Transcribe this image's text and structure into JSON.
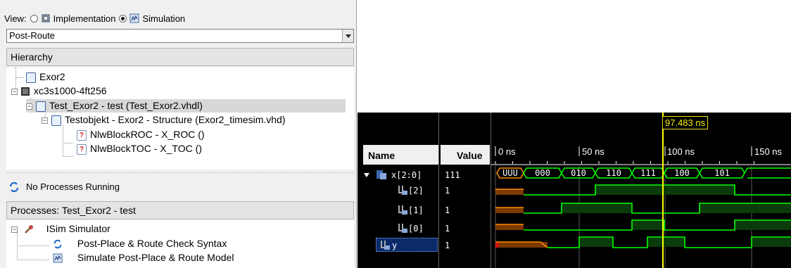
{
  "view": {
    "label": "View:",
    "options": [
      "Implementation",
      "Simulation"
    ],
    "selected": "Simulation"
  },
  "design_combo": {
    "value": "Post-Route"
  },
  "hierarchy": {
    "title": "Hierarchy",
    "items": [
      {
        "label": "Exor2",
        "icon": "document-icon"
      },
      {
        "label": "xc3s1000-4ft256",
        "icon": "chip-icon"
      },
      {
        "label": "Test_Exor2 - test (Test_Exor2.vhdl)",
        "icon": "vhdl-file-icon"
      },
      {
        "label": "Testobjekt - Exor2 - Structure (Exor2_timesim.vhd)",
        "icon": "vhdl-file-icon"
      },
      {
        "label": "NlwBlockROC - X_ROC ()",
        "icon": "unknown-file-icon"
      },
      {
        "label": "NlwBlockTOC - X_TOC ()",
        "icon": "unknown-file-icon"
      }
    ]
  },
  "status": {
    "text": "No Processes Running"
  },
  "processes": {
    "title": "Processes: Test_Exor2 - test",
    "items": [
      {
        "label": "ISim Simulator",
        "icon": "tools-icon"
      },
      {
        "label": "Post-Place & Route Check Syntax",
        "icon": "refresh-icon"
      },
      {
        "label": "Simulate Post-Place & Route Model",
        "icon": "isim-icon"
      }
    ]
  },
  "waveform": {
    "name_header": "Name",
    "value_header": "Value",
    "cursor_label": "97.483 ns",
    "ticks": [
      "0 ns",
      "50 ns",
      "100 ns",
      "150 ns"
    ],
    "signals": [
      {
        "name": "x[2:0]",
        "value": "111",
        "bus_values": [
          "UUU",
          "000",
          "010",
          "110",
          "111",
          "100",
          "101"
        ]
      },
      {
        "name": "[2]",
        "value": "1"
      },
      {
        "name": "[1]",
        "value": "1"
      },
      {
        "name": "[0]",
        "value": "1"
      },
      {
        "name": "y",
        "value": "1"
      }
    ],
    "colors": {
      "signal": "#00ff00",
      "undefined": "#ff8c00",
      "cursor": "#ffff00",
      "grid": "#ffffff"
    }
  }
}
